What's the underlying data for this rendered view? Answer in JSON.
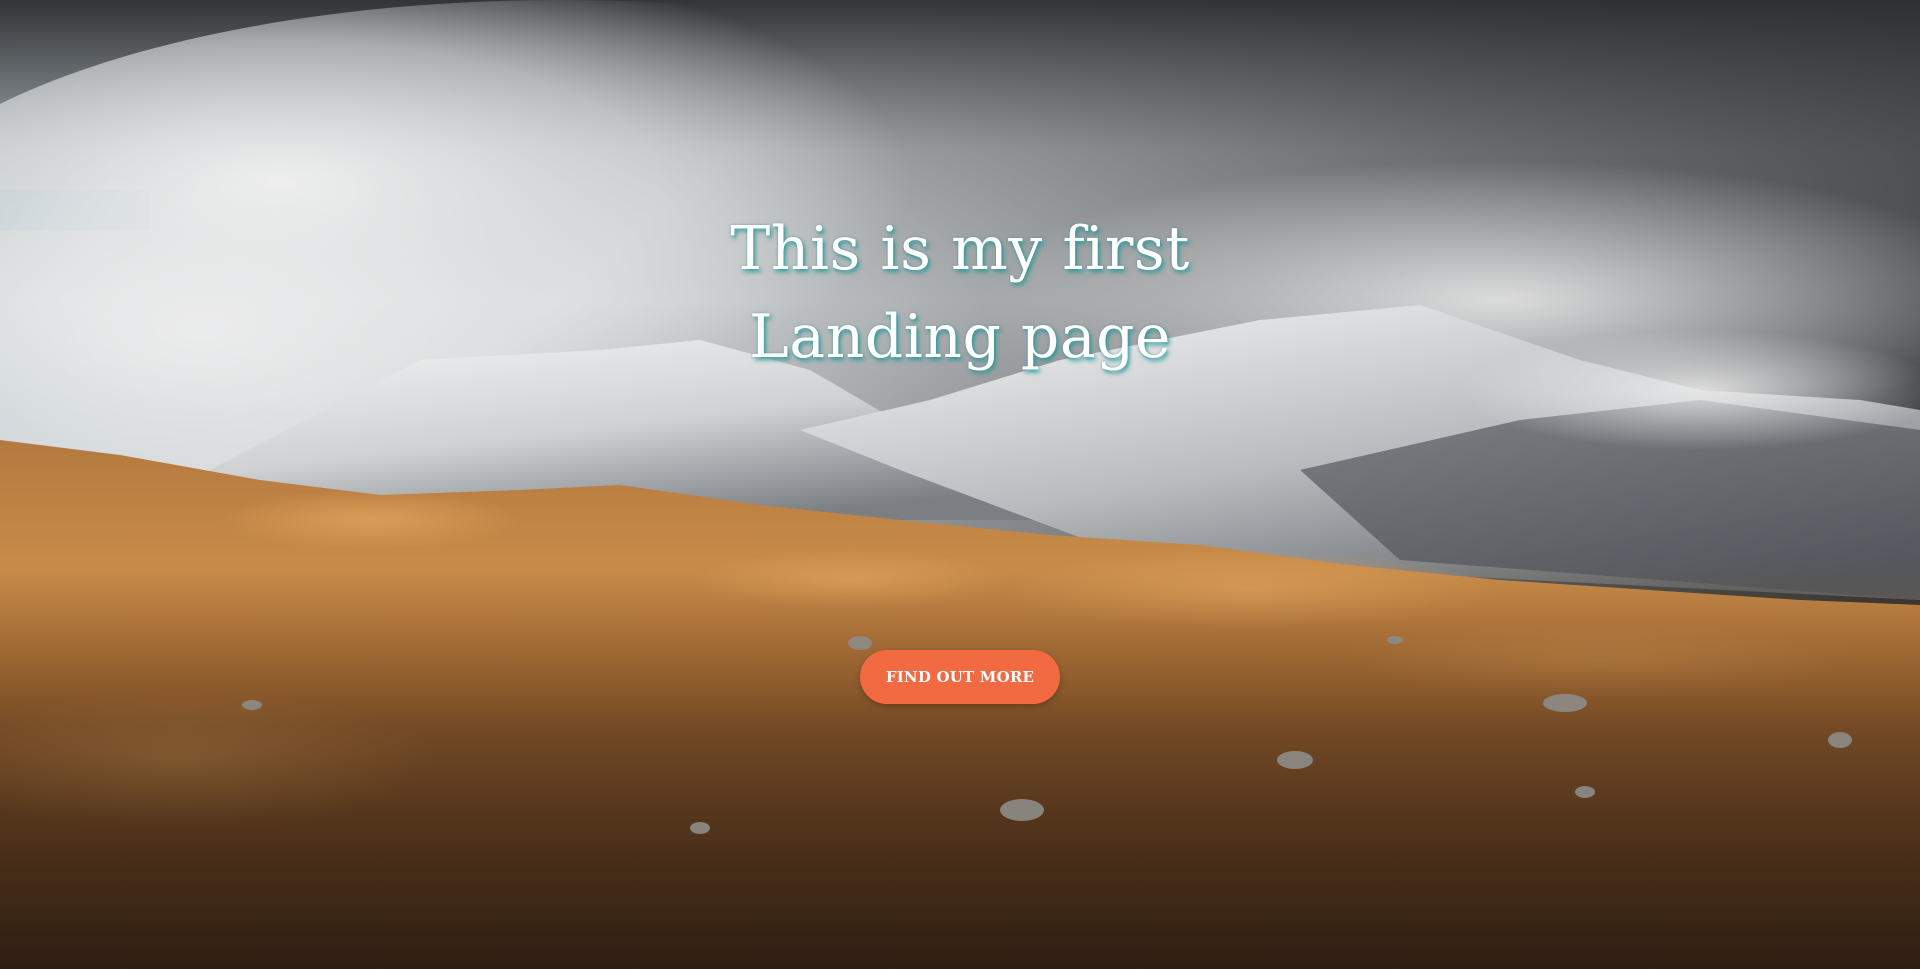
{
  "hero": {
    "title_line1": "This is my first",
    "title_line2": "Landing page",
    "button_label": "FIND OUT MORE",
    "background_image": "mountain-landscape-image"
  },
  "colors": {
    "button": "#f26a42",
    "title_text": "#ffffff",
    "title_shadow": "#1e9696"
  }
}
